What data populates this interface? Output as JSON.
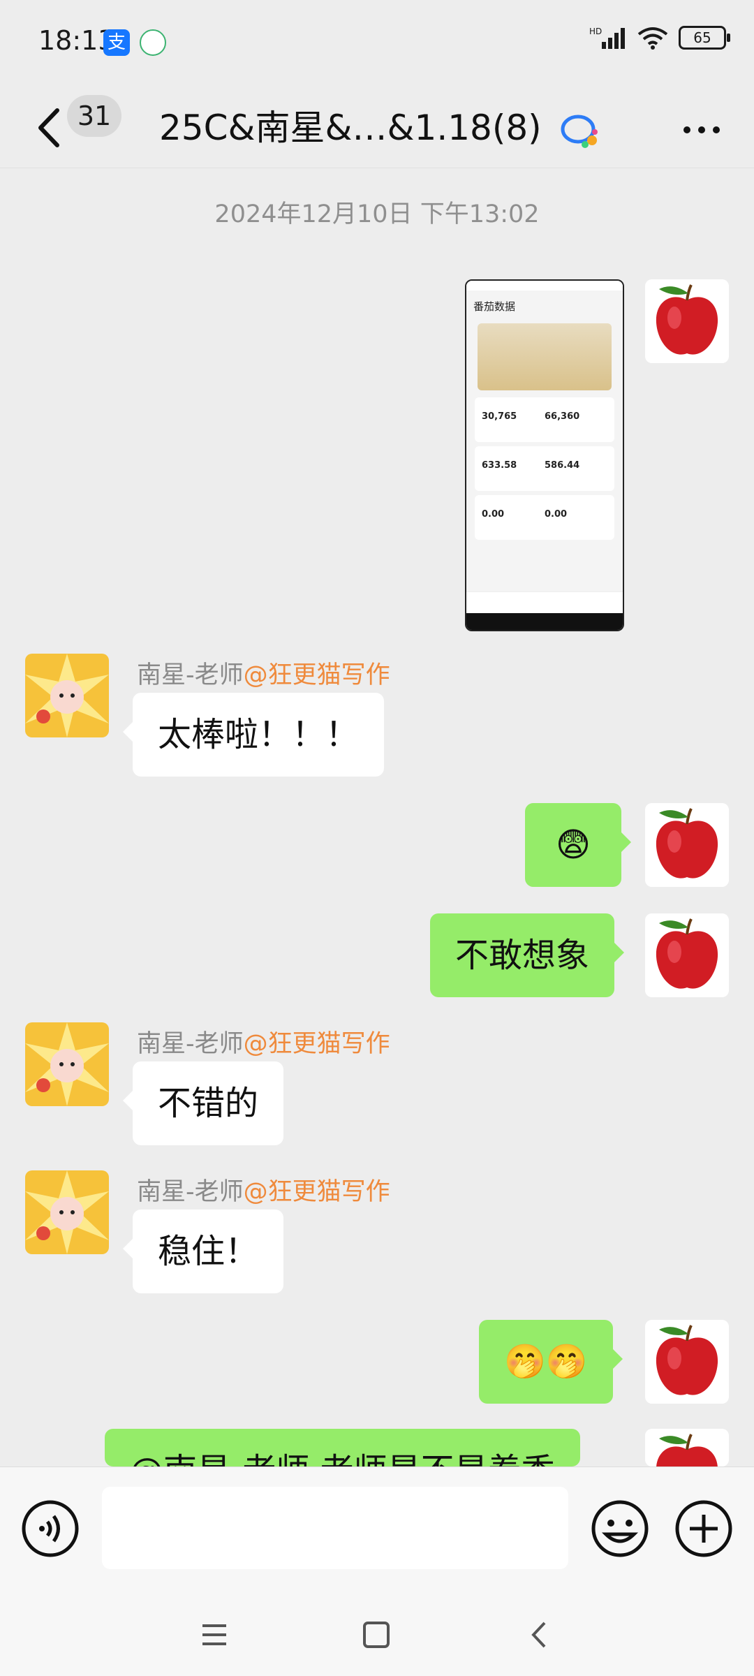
{
  "status_bar": {
    "time": "18:13",
    "battery": "65",
    "signal_label": "HD"
  },
  "header": {
    "unread_count": "31",
    "title": "25C&南星&…&1.18(8)"
  },
  "chat": {
    "timestamp": "2024年12月10日 下午13:02",
    "screenshot": {
      "title": "番茄数据",
      "stats": [
        {
          "value": "30,765"
        },
        {
          "value": "66,360"
        },
        {
          "value": "633.58"
        },
        {
          "value": "586.44"
        },
        {
          "value": "0.00"
        },
        {
          "value": "0.00"
        }
      ]
    },
    "messages": [
      {
        "sender": "南星-老师",
        "mention": "@狂更猫写作",
        "text": "太棒啦！！！"
      },
      {
        "text": "😨"
      },
      {
        "text": "不敢想象"
      },
      {
        "sender": "南星-老师",
        "mention": "@狂更猫写作",
        "text": "不错的"
      },
      {
        "sender": "南星-老师",
        "mention": "@狂更猫写作",
        "text": "稳住！"
      },
      {
        "text": "🤭🤭"
      },
      {
        "text": "@南星-老师  老师是不是着香"
      }
    ]
  },
  "colors": {
    "accent_orange": "#ef8a3c",
    "bubble_green": "#95ec69",
    "background": "#ededed"
  }
}
